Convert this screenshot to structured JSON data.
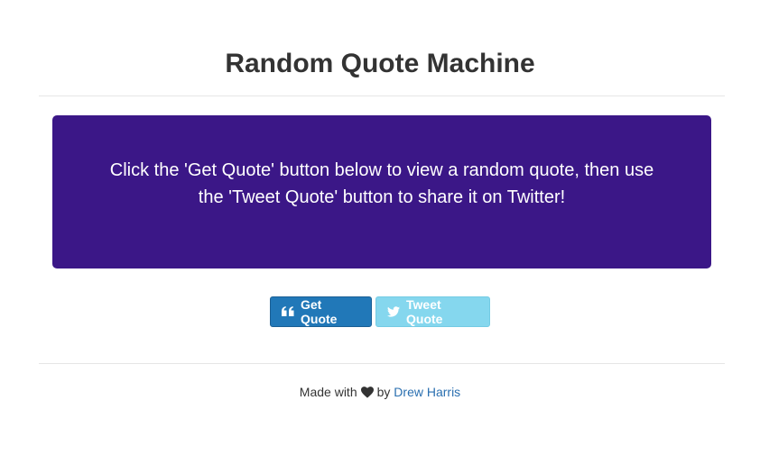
{
  "header": {
    "title": "Random Quote Machine"
  },
  "quote": {
    "text": "Click the 'Get Quote' button below to view a random quote, then use the 'Tweet Quote' button to share it on Twitter!",
    "background_color": "#3b1787"
  },
  "buttons": {
    "get_quote": {
      "label": "Get Quote",
      "icon": "quote-left-icon",
      "color": "#2178b8"
    },
    "tweet_quote": {
      "label": "Tweet Quote",
      "icon": "twitter-icon",
      "color": "#85d7ee"
    }
  },
  "footer": {
    "made_with": "Made with",
    "heart_icon": "heart-icon",
    "by": "by",
    "author": "Drew Harris",
    "author_link_color": "#2a6fb0"
  }
}
